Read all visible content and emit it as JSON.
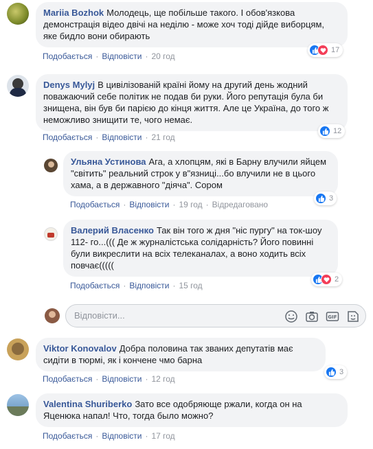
{
  "comments": [
    {
      "author": "Mariia Bozhok",
      "text": "Молодець, ще побільше такого. І обов'язкова демонстрація відео двічі на неділю - може хоч тоді дійде виборцям, яке бидло вони обирають",
      "like": "Подобається",
      "reply": "Відповісти",
      "time": "20 год",
      "reactions": "17"
    },
    {
      "author": "Denys Mylyj",
      "text": "В цивілізованій країні йому на другий день жодний поважаючий себе політик не подав би руки. Його репутація була би знищена, він був би парією до кінця життя. Але це Україна, до того ж неможливо знищити те, чого немає.",
      "like": "Подобається",
      "reply": "Відповісти",
      "time": "21 год",
      "reactions": "12"
    },
    {
      "author": "Ульяна Устинова",
      "text": "Ага, а хлопцям, які в Барну влучили яйцем \"світить\" реальний строк у в\"язниці...бо влучили не в цього хама, а в державного \"діяча\". Сором",
      "like": "Подобається",
      "reply": "Відповісти",
      "time": "19 год",
      "edited": "Відредаговано",
      "reactions": "3"
    },
    {
      "author": "Валерий Власенко",
      "text": "Так він того ж дня \"ніс пургу\" на ток-шоу 112- го...((( Де ж журналістська солідарність? Його повинні були викреслити на всіх телеканалах, а воно ходить всіх повчає(((((",
      "like": "Подобається",
      "reply": "Відповісти",
      "time": "15 год",
      "reactions": "2"
    },
    {
      "author": "Viktor Konovalov",
      "text": "Добра половина так званих депутатів має сидіти в тюрмі, як і кончене чмо барна",
      "like": "Подобається",
      "reply": "Відповісти",
      "time": "12 год",
      "reactions": "3"
    },
    {
      "author": "Valentina Shuriberko",
      "text": "Зато все одобряюще ржали, когда он на Яценюка напал! Что, тогда было можно?",
      "like": "Подобається",
      "reply": "Відповісти",
      "time": "17 год"
    }
  ],
  "reply_box": {
    "placeholder": "Відповісти..."
  },
  "icons": [
    "emoji-icon",
    "camera-icon",
    "gif-icon",
    "sticker-icon",
    "like-icon",
    "love-icon"
  ],
  "colors": {
    "link": "#385898",
    "bubble": "#f2f3f5",
    "meta": "#90949c",
    "like": "#1877f2",
    "love": "#f33e58"
  }
}
